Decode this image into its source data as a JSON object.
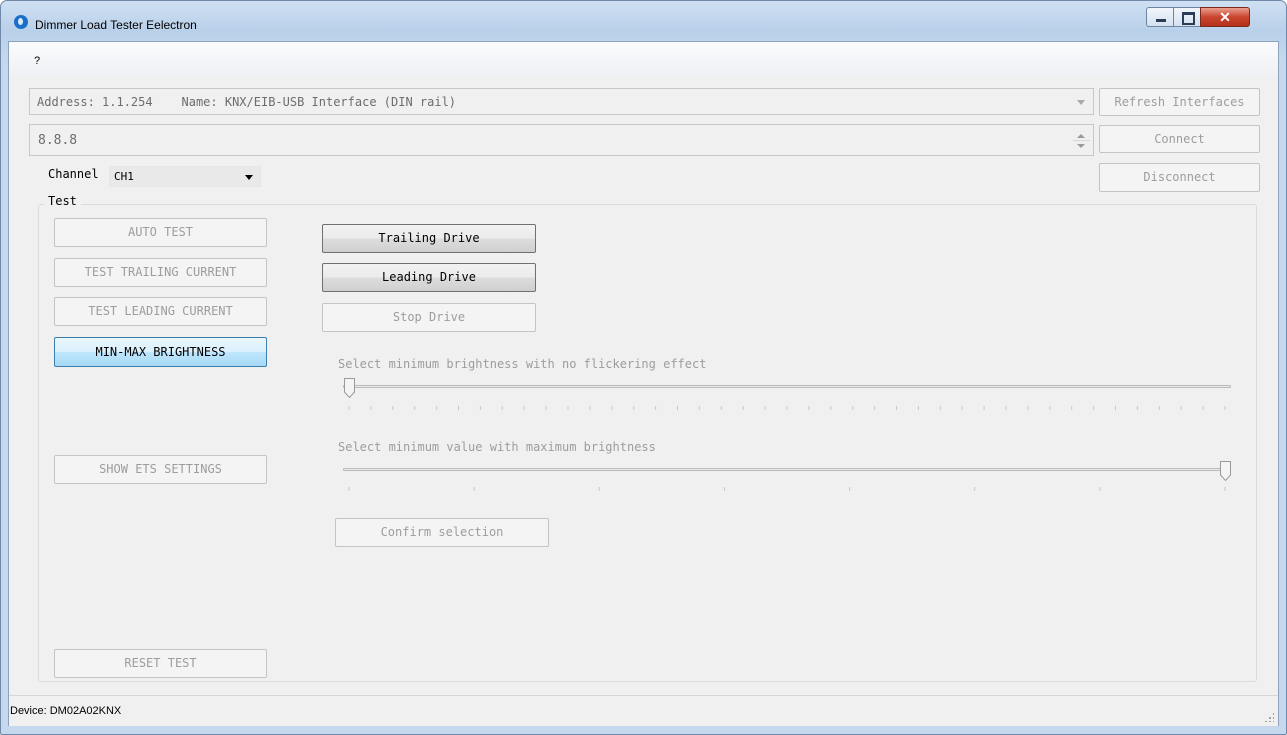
{
  "window": {
    "title": "Dimmer Load Tester Eelectron"
  },
  "menu": {
    "items": [
      "?"
    ]
  },
  "connection": {
    "interface_value": "Address: 1.1.254    Name: KNX/EIB-USB Interface (DIN rail)",
    "device_address": "8.8.8",
    "refresh_label": "Refresh Interfaces",
    "connect_label": "Connect",
    "disconnect_label": "Disconnect"
  },
  "channel": {
    "label": "Channel",
    "value": "CH1"
  },
  "test_group": {
    "label": "Test",
    "auto_test": "AUTO TEST",
    "test_trailing": "TEST TRAILING CURRENT",
    "test_leading": "TEST LEADING CURRENT",
    "min_max": "MIN-MAX BRIGHTNESS",
    "show_ets": "SHOW ETS SETTINGS",
    "reset_test": "RESET TEST",
    "trailing_drive": "Trailing Drive",
    "leading_drive": "Leading Drive",
    "stop_drive": "Stop Drive",
    "slider_min_label": "Select minimum brightness with no flickering effect",
    "slider_min_value": 0,
    "slider_max_label": "Select minimum value with maximum brightness",
    "slider_max_value": 1,
    "confirm": "Confirm selection"
  },
  "status": {
    "text": "Device: DM02A02KNX"
  }
}
